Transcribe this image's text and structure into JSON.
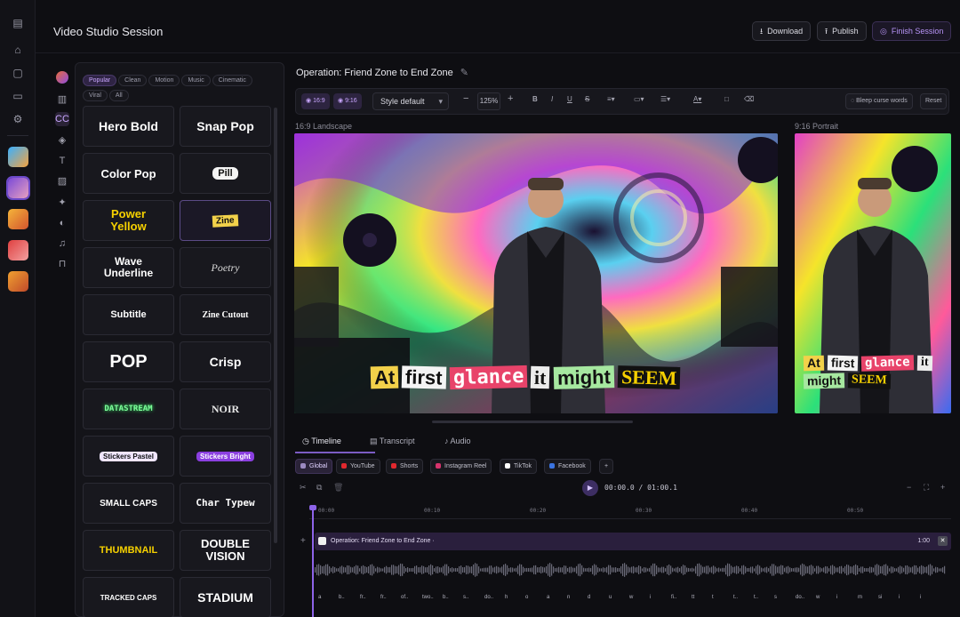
{
  "app": {
    "title": "Video Studio Session"
  },
  "rail": {
    "icons": [
      "panel-toggle-icon",
      "home-icon",
      "clipboard-icon",
      "folder-icon",
      "gear-icon"
    ]
  },
  "header": {
    "download_label": "Download",
    "publish_label": "Publish",
    "finish_label": "Finish Session"
  },
  "filters": [
    "Popular",
    "Clean",
    "Motion",
    "Music",
    "Cinematic",
    "Viral",
    "All"
  ],
  "styles": [
    {
      "label": "Hero Bold",
      "font": "sans",
      "size": 14,
      "color": "#ffffff"
    },
    {
      "label": "Snap Pop",
      "font": "sans",
      "size": 14,
      "color": "#ffffff"
    },
    {
      "label": "Color Pop",
      "font": "sans",
      "size": 13,
      "color": "#ffffff"
    },
    {
      "label": "Pill",
      "font": "sans",
      "size": 11,
      "color": "#111111"
    },
    {
      "label": "Power Yellow",
      "font": "sans",
      "size": 13,
      "color": "#f5d000"
    },
    {
      "label": "Zine",
      "font": "sans",
      "size": 10,
      "color": "#111111"
    },
    {
      "label": "Wave Underline",
      "font": "sans",
      "size": 12,
      "color": "#ffffff"
    },
    {
      "label": "Poetry",
      "font": "serif",
      "size": 12,
      "color": "#d8d8d8"
    },
    {
      "label": "Subtitle",
      "font": "sans",
      "size": 11,
      "color": "#ffffff"
    },
    {
      "label": "Zine Cutout",
      "font": "serif",
      "size": 10,
      "color": "#ffffff"
    },
    {
      "label": "POP",
      "font": "sans",
      "size": 20,
      "color": "#ffffff"
    },
    {
      "label": "Crisp",
      "font": "sans",
      "size": 14,
      "color": "#ffffff"
    },
    {
      "label": "DATASTREAM",
      "font": "mono",
      "size": 9,
      "color": "#7dff9a"
    },
    {
      "label": "NOIR",
      "font": "serif",
      "size": 12,
      "color": "#e6e6e6"
    },
    {
      "label": "Stickers Pastel",
      "font": "sans",
      "size": 8,
      "color": "#111111"
    },
    {
      "label": "Stickers Bright",
      "font": "sans",
      "size": 8,
      "color": "#ffffff"
    },
    {
      "label": "SMALL CAPS",
      "font": "sans",
      "size": 10,
      "color": "#ffffff"
    },
    {
      "label": "Char Typew",
      "font": "mono",
      "size": 11,
      "color": "#ffffff"
    },
    {
      "label": "THUMBNAIL",
      "font": "sans",
      "size": 11,
      "color": "#f5d000"
    },
    {
      "label": "DOUBLE VISION",
      "font": "sans",
      "size": 13,
      "color": "#ffffff"
    },
    {
      "label": "TRACKED CAPS",
      "font": "sans",
      "size": 8,
      "color": "#ffffff"
    },
    {
      "label": "STADIUM",
      "font": "sans",
      "size": 14,
      "color": "#ffffff"
    }
  ],
  "editor": {
    "operation_title": "Operation: Friend Zone to End Zone",
    "aspect_pills": [
      "16:9",
      "9:16"
    ],
    "style_select": "Style default",
    "zoom": "125%",
    "bleep_label": "Bleep curse words",
    "reset_label": "Reset",
    "landscape_label": "16:9 Landscape",
    "portrait_label": "9:16 Portrait"
  },
  "caption": {
    "words": [
      {
        "text": "At",
        "bg": "#f2d14a",
        "fg": "#111111",
        "font": "sans"
      },
      {
        "text": "first",
        "bg": "#f4f4f4",
        "fg": "#111111",
        "font": "sans"
      },
      {
        "text": "glance",
        "bg": "#e8436a",
        "fg": "#ffffff",
        "font": "mono"
      },
      {
        "text": "it",
        "bg": "#ececec",
        "fg": "#111111",
        "font": "serif"
      },
      {
        "text": "might",
        "bg": "#a6e8a0",
        "fg": "#111111",
        "font": "sans"
      },
      {
        "text": "SEEM",
        "bg": "#111111",
        "fg": "#f5d000",
        "font": "serif"
      }
    ]
  },
  "timeline": {
    "tabs": [
      "Timeline",
      "Transcript",
      "Audio"
    ],
    "platforms": [
      {
        "label": "Global",
        "color": "#9b8ac0"
      },
      {
        "label": "YouTube",
        "color": "#e0282e"
      },
      {
        "label": "Shorts",
        "color": "#e0282e"
      },
      {
        "label": "Instagram Reel",
        "color": "#d6336c"
      },
      {
        "label": "TikTok",
        "color": "#ffffff"
      },
      {
        "label": "Facebook",
        "color": "#3b74e0"
      }
    ],
    "timecode": "00:00.0 / 01:00.1",
    "ticks": [
      "00:00",
      "00:10",
      "00:20",
      "00:30",
      "00:40",
      "00:50"
    ],
    "track_label": "Operation: Friend Zone to End Zone ·",
    "track_duration": "1:00",
    "words": [
      "a",
      "b..",
      "fr..",
      "fr..",
      "of..",
      "two..",
      "b..",
      "s..",
      "do..",
      "h",
      "o",
      "a",
      "n",
      "d",
      "u",
      "w",
      "i",
      "fi..",
      "tt",
      "t",
      "t..",
      "t..",
      "s",
      "do..",
      "w",
      "i",
      "m",
      "si",
      "i",
      "i"
    ]
  }
}
